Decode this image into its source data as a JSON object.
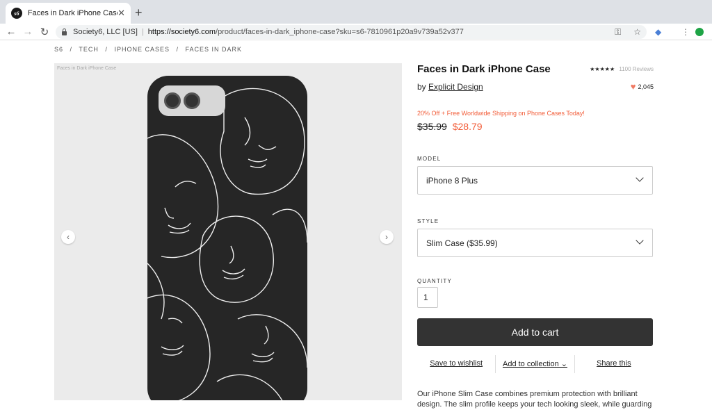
{
  "browser": {
    "tab_title": "Faces in Dark iPhone Case by Explicit Design",
    "tab_close": "✕",
    "new_tab": "+",
    "back": "←",
    "forward": "→",
    "reload": "↻",
    "site_identity": "Society6, LLC [US]",
    "url_domain": "https://society6.com",
    "url_path": "/product/faces-in-dark_iphone-case?sku=s6-7810961p20a9v739a52v377"
  },
  "breadcrumb": [
    "S6",
    "/",
    "TECH",
    "/",
    "IPHONE CASES",
    "/",
    "FACES IN DARK"
  ],
  "gallery": {
    "caption": "Faces in Dark iPhone Case",
    "prev": "‹",
    "next": "›"
  },
  "product": {
    "title": "Faces in Dark iPhone Case",
    "stars": "★★★★★",
    "reviews": "1100 Reviews",
    "by": "by",
    "artist": "Explicit Design",
    "likes": "2,045",
    "promo": "20% Off + Free Worldwide Shipping on Phone Cases Today!",
    "old_price": "$35.99",
    "new_price": "$28.79"
  },
  "options": {
    "model_label": "MODEL",
    "model_value": "iPhone 8 Plus",
    "style_label": "STYLE",
    "style_value": "Slim Case ($35.99)",
    "quantity_label": "QUANTITY",
    "quantity_value": "1"
  },
  "actions": {
    "add_to_cart": "Add to cart",
    "wishlist": "Save to wishlist",
    "collection": "Add to collection ⌄",
    "share": "Share this"
  },
  "description": "Our iPhone Slim Case combines premium protection with brilliant design. The slim profile keeps your tech looking sleek, while guarding",
  "colors": {
    "accent": "#f25c38",
    "case_bg": "#262626",
    "button_bg": "#333333"
  }
}
